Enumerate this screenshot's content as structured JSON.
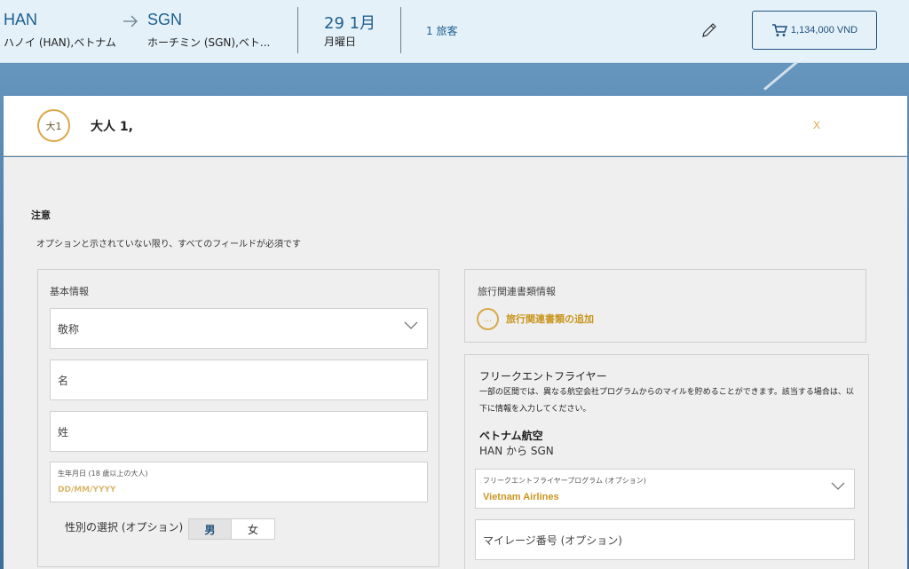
{
  "header": {
    "origin_code": "HAN",
    "origin_name": "ハノイ (HAN),ベトナム",
    "dest_code": "SGN",
    "dest_name": "ホーチミン (SGN),ベト...",
    "date": "29 1月",
    "weekday": "月曜日",
    "travelers": "1 旅客",
    "cart_total": "1,134,000 VND",
    "icons": {
      "arrow": "arrow-right-icon",
      "edit": "pencil-icon",
      "cart": "cart-icon"
    }
  },
  "passenger": {
    "badge": "大1",
    "title": "大人 1,",
    "close": "X"
  },
  "notice": {
    "title": "注意",
    "text": "オプションと示されていない限り、すべてのフィールドが必須です"
  },
  "basic_info": {
    "title": "基本情報",
    "title_field": "敬称",
    "first_name": "名",
    "last_name": "姓",
    "dob_label": "生年月日 (18 歳以上の大人)",
    "dob_placeholder": "DD/MM/YYYY",
    "gender_label": "性別の選択 (オプション)",
    "gender_male": "男",
    "gender_female": "女"
  },
  "travel_docs": {
    "title": "旅行関連書類情報",
    "add_icon": "…",
    "add_label": "旅行関連書類の追加"
  },
  "frequent_flyer": {
    "title": "フリークエントフライヤー",
    "description": "一部の区間では、異なる航空会社プログラムからのマイルを貯めることができます。該当する場合は、以下に情報を入力してください。",
    "airline": "ベトナム航空",
    "route": "HAN から SGN",
    "program_label": "フリークエントフライヤープログラム (オプション)",
    "program_value": "Vietnam Airlines",
    "mileage_placeholder": "マイレージ番号 (オプション)"
  },
  "colors": {
    "accent_gold": "#d9a84a",
    "brand_blue": "#1f5f8f"
  }
}
